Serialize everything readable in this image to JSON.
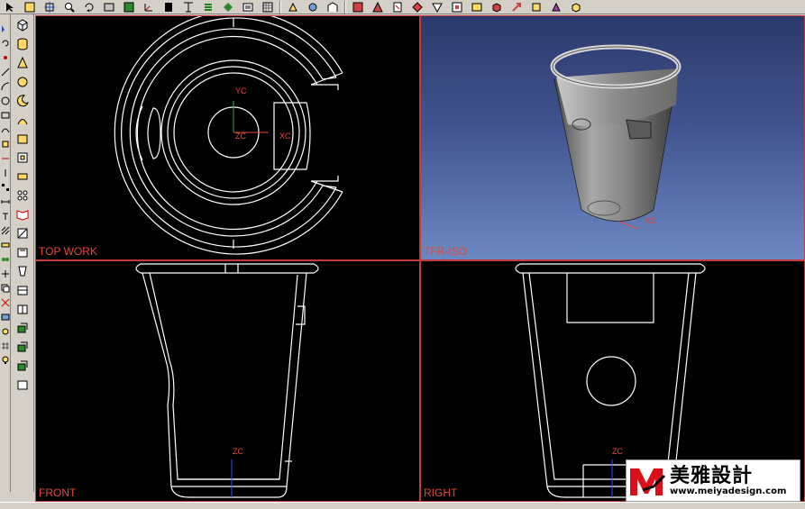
{
  "viewports": {
    "top": {
      "label": "TOP WORK",
      "axes": {
        "y": "YC",
        "z": "ZC",
        "x": "XC"
      }
    },
    "iso": {
      "label": "TFR-ISO",
      "axes": {
        "x": "XC"
      }
    },
    "front": {
      "label": "FRONT",
      "axes": {
        "z": "ZC"
      }
    },
    "right": {
      "label": "RIGHT",
      "axes": {
        "z": "ZC"
      }
    }
  },
  "watermark": {
    "chinese": "美雅設計",
    "url": "www.meiyadesign.com"
  },
  "colors": {
    "viewport_border": "#c43a3a",
    "label": "#e8463a",
    "wireframe": "#ffffff",
    "axis_y": "#33aa33",
    "axis_x": "#e8463a",
    "axis_z": "#3050ff",
    "watermark_red": "#d9101a"
  },
  "toolbar_icons": [
    "cursor-icon",
    "snap-icon",
    "fit-icon",
    "zoom-icon",
    "rotate-icon",
    "pan-icon",
    "layer-icon",
    "wcs-icon",
    "render-icon",
    "shade-icon",
    "hidden-icon",
    "wireframe-icon",
    "sketch-icon",
    "extrude-icon",
    "revolve-icon",
    "hole-icon",
    "boss-icon",
    "blend-icon",
    "chamfer-icon",
    "shell-icon",
    "info-icon",
    "analysis-icon",
    "layout-icon",
    "display-icon"
  ]
}
